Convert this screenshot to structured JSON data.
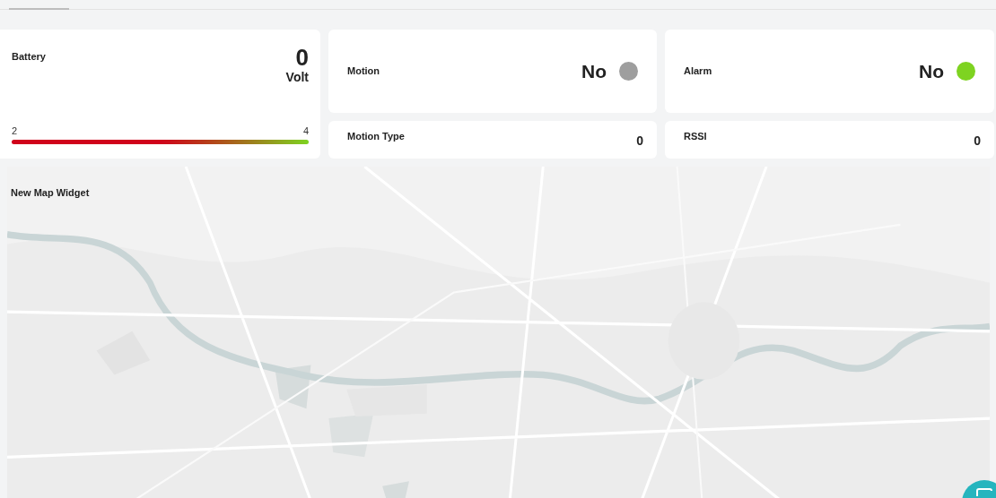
{
  "battery": {
    "title": "Battery",
    "value": "0",
    "unit": "Volt",
    "min": "2",
    "max": "4"
  },
  "motion": {
    "title": "Motion",
    "value": "No",
    "color": "#9e9e9e"
  },
  "alarm": {
    "title": "Alarm",
    "value": "No",
    "color": "#7ed321"
  },
  "motion_type": {
    "title": "Motion Type",
    "value": "0"
  },
  "rssi": {
    "title": "RSSI",
    "value": "0"
  },
  "map": {
    "title": "New Map Widget",
    "kind": "picture"
  }
}
